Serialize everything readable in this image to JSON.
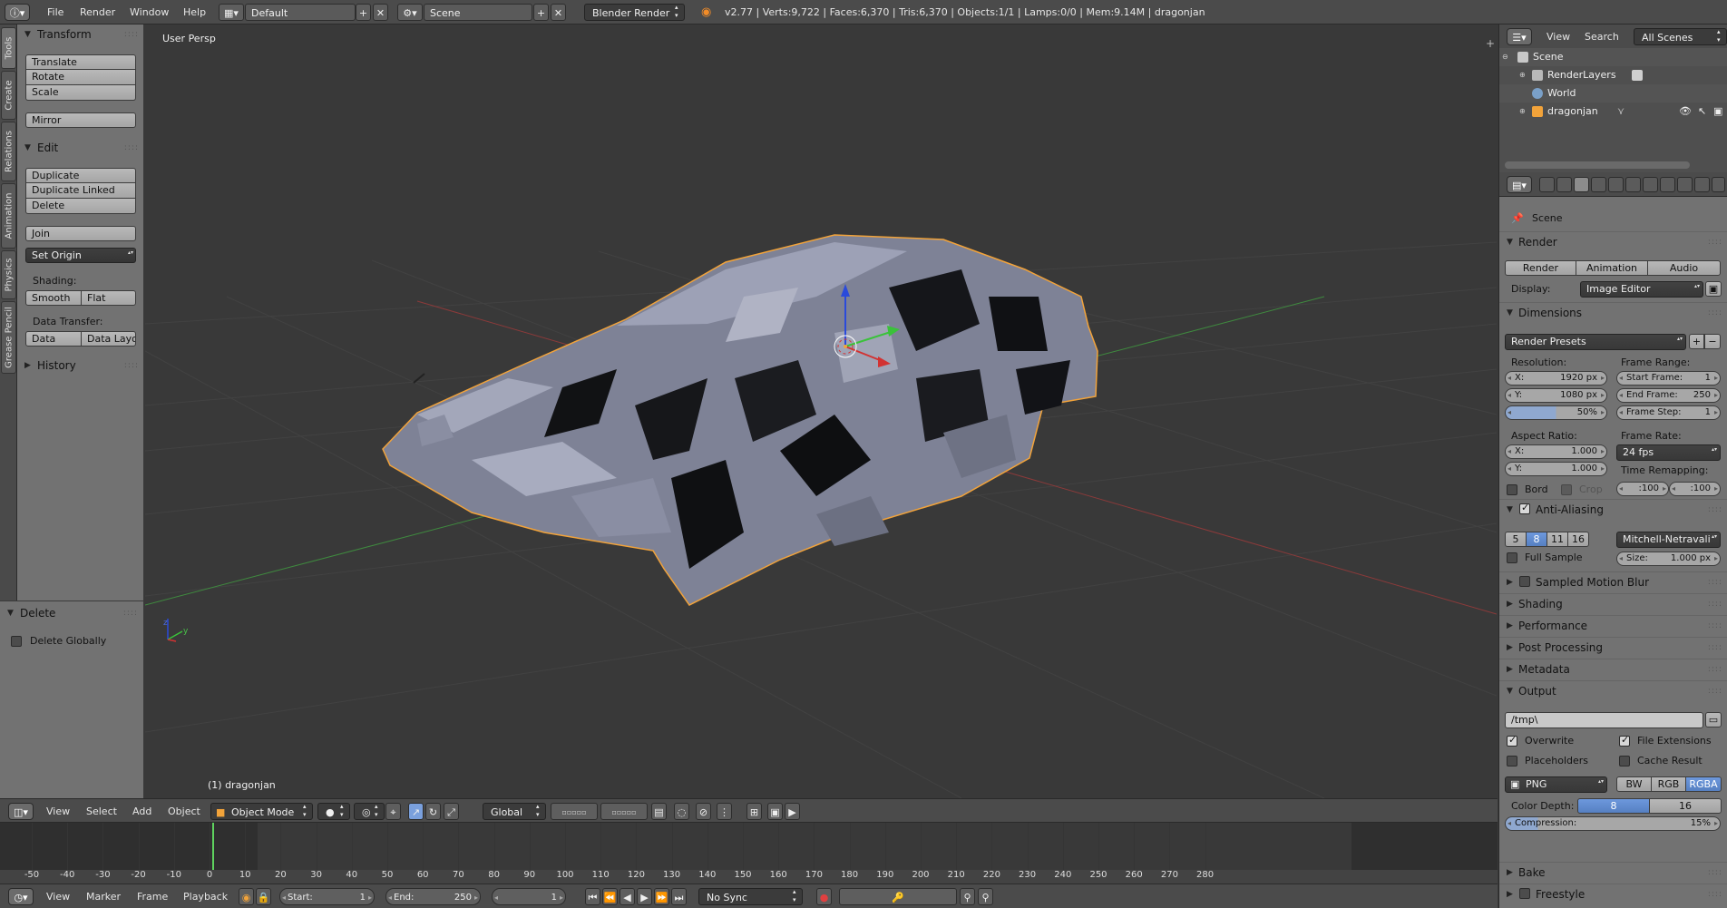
{
  "info_header": {
    "menus": [
      "File",
      "Render",
      "Window",
      "Help"
    ],
    "screen_layout": "Default",
    "scene": "Scene",
    "render_engine": "Blender Render",
    "stats": "v2.77 | Verts:9,722 | Faces:6,370 | Tris:6,370 | Objects:1/1 | Lamps:0/0 | Mem:9.14M | dragonjan"
  },
  "vertical_tabs": [
    "Tools",
    "Create",
    "Relations",
    "Animation",
    "Physics",
    "Grease Pencil"
  ],
  "tool_shelf": {
    "transform": {
      "title": "Transform",
      "translate": "Translate",
      "rotate": "Rotate",
      "scale": "Scale",
      "mirror": "Mirror"
    },
    "edit": {
      "title": "Edit",
      "duplicate": "Duplicate",
      "duplicate_linked": "Duplicate Linked",
      "delete": "Delete",
      "join": "Join",
      "set_origin": "Set Origin"
    },
    "shading": {
      "label": "Shading:",
      "smooth": "Smooth",
      "flat": "Flat"
    },
    "data_transfer": {
      "label": "Data Transfer:",
      "data": "Data",
      "data_layout": "Data Layo"
    },
    "history": "History"
  },
  "operator_panel": {
    "title": "Delete",
    "delete_globally": "Delete Globally"
  },
  "viewport": {
    "view_name": "User Persp",
    "active_object": "(1) dragonjan"
  },
  "view3d_header": {
    "menus": [
      "View",
      "Select",
      "Add",
      "Object"
    ],
    "mode": "Object Mode",
    "orientation": "Global"
  },
  "timeline": {
    "ticks": [
      "-50",
      "-40",
      "-30",
      "-20",
      "-10",
      "0",
      "10",
      "20",
      "30",
      "40",
      "50",
      "60",
      "70",
      "80",
      "90",
      "100",
      "110",
      "120",
      "130",
      "140",
      "150",
      "160",
      "170",
      "180",
      "190",
      "200",
      "210",
      "220",
      "230",
      "240",
      "250",
      "260",
      "270",
      "280"
    ],
    "current_frame": 1,
    "menus": [
      "View",
      "Marker",
      "Frame",
      "Playback"
    ],
    "start_label": "Start:",
    "start": "1",
    "end_label": "End:",
    "end": "250",
    "frame": "1",
    "sync": "No Sync"
  },
  "outliner": {
    "menus": [
      "View",
      "Search"
    ],
    "filter": "All Scenes",
    "items": [
      "Scene",
      "RenderLayers",
      "World",
      "dragonjan"
    ]
  },
  "properties": {
    "context": "Scene",
    "render": {
      "title": "Render",
      "render_btn": "Render",
      "animation_btn": "Animation",
      "audio_btn": "Audio",
      "display_label": "Display:",
      "display": "Image Editor"
    },
    "dimensions": {
      "title": "Dimensions",
      "presets": "Render Presets",
      "resolution_label": "Resolution:",
      "res_x_label": "X:",
      "res_x": "1920 px",
      "res_y_label": "Y:",
      "res_y": "1080 px",
      "res_pct": "50%",
      "frame_range_label": "Frame Range:",
      "start_frame_label": "Start Frame:",
      "start_frame": "1",
      "end_frame_label": "End Frame:",
      "end_frame": "250",
      "frame_step_label": "Frame Step:",
      "frame_step": "1",
      "aspect_label": "Aspect Ratio:",
      "asp_x_label": "X:",
      "asp_x": "1.000",
      "asp_y_label": "Y:",
      "asp_y": "1.000",
      "frame_rate_label": "Frame Rate:",
      "frame_rate": "24 fps",
      "time_remap_label": "Time Remapping:",
      "remap_old": ":100",
      "remap_new": ":100",
      "border": "Bord",
      "crop": "Crop"
    },
    "anti_aliasing": {
      "title": "Anti-Aliasing",
      "samples": [
        "5",
        "8",
        "11",
        "16"
      ],
      "selected_sample": "8",
      "filter": "Mitchell-Netravali",
      "full_sample": "Full Sample",
      "size_label": "Size:",
      "size": "1.000 px"
    },
    "collapsed_panels": [
      "Sampled Motion Blur",
      "Shading",
      "Performance",
      "Post Processing",
      "Metadata"
    ],
    "output": {
      "title": "Output",
      "path": "/tmp\\",
      "overwrite": "Overwrite",
      "file_extensions": "File Extensions",
      "placeholders": "Placeholders",
      "cache_result": "Cache Result",
      "format": "PNG",
      "color_modes": [
        "BW",
        "RGB",
        "RGBA"
      ],
      "selected_color_mode": "RGBA",
      "color_depth_label": "Color Depth:",
      "depths": [
        "8",
        "16"
      ],
      "selected_depth": "8",
      "compression_label": "Compression:",
      "compression": "15%"
    },
    "bottom_panels": [
      "Bake",
      "Freestyle"
    ]
  },
  "colors": {
    "selection_outline": "#f2a33a",
    "x_axis": "#d23232",
    "y_axis": "#3ac23a",
    "z_axis": "#2a4adb",
    "accent_blue": "#5680c2"
  }
}
